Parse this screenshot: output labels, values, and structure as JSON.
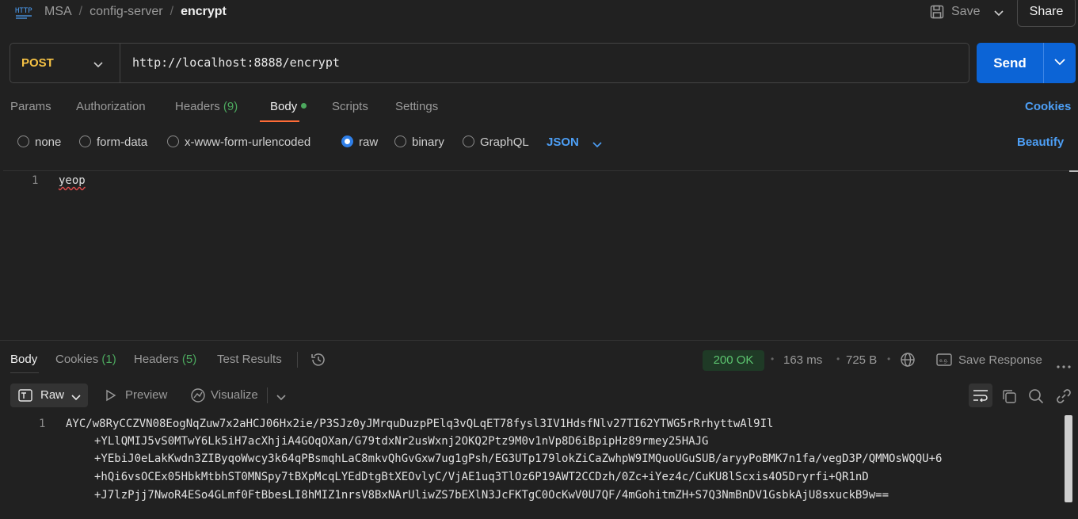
{
  "header": {
    "app_icon": "http-icon",
    "breadcrumb": [
      "MSA",
      "config-server"
    ],
    "current": "encrypt",
    "save_label": "Save",
    "share_label": "Share"
  },
  "request": {
    "method": "POST",
    "url": "http://localhost:8888/encrypt",
    "send_label": "Send"
  },
  "request_tabs": {
    "params": "Params",
    "authorization": "Authorization",
    "headers": "Headers",
    "headers_count": "(9)",
    "body": "Body",
    "scripts": "Scripts",
    "settings": "Settings",
    "cookies": "Cookies"
  },
  "body_types": {
    "none": "none",
    "form_data": "form-data",
    "urlencoded": "x-www-form-urlencoded",
    "raw": "raw",
    "binary": "binary",
    "graphql": "GraphQL",
    "selected": "raw",
    "language": "JSON",
    "beautify": "Beautify"
  },
  "editor": {
    "line_number": "1",
    "content": "yeop"
  },
  "response_tabs": {
    "body": "Body",
    "cookies": "Cookies",
    "cookies_count": "(1)",
    "headers": "Headers",
    "headers_count": "(5)",
    "test_results": "Test Results"
  },
  "response_meta": {
    "status": "200 OK",
    "time": "163 ms",
    "size": "725 B",
    "save_response": "Save Response"
  },
  "response_toolbar": {
    "format": "Raw",
    "preview": "Preview",
    "visualize": "Visualize"
  },
  "response_body": {
    "line_number": "1",
    "lines": [
      "AYC/w8RyCCZVN08EogNqZuw7x2aHCJ06Hx2ie/P3SJz0yJMrquDuzpPElq3vQLqET78fysl3IV1HdsfNlv27TI62YTWG5rRrhyttwAl9Il",
      "+YLlQMIJ5vS0MTwY6Lk5iH7acXhjiA4GOqOXan/G79tdxNr2usWxnj2OKQ2Ptz9M0v1nVp8D6iBpipHz89rmey25HAJG",
      "+YEbiJ0eLakKwdn3ZIByqoWwcy3k64qPBsmqhLaC8mkvQhGvGxw7ug1gPsh/EG3UTp179lokZiCaZwhpW9IMQuoUGuSUB/aryyPoBMK7n1fa/vegD3P/QMMOsWQQU+6",
      "+hQi6vsOCEx05HbkMtbhST0MNSpy7tBXpMcqLYEdDtgBtXEOvlyC/VjAE1uq3TlOz6P19AWT2CCDzh/0Zc+iYez4c/CuKU8lScxis4O5Dryrfi+QR1nD",
      "+J7lzPjj7NwoR4ESo4GLmf0FtBbesLI8hMIZ1nrsV8BxNArUliwZS7bEXlN3JcFKTgC0OcKwV0U7QF/4mGohitmZH+S7Q3NmBnDV1GsbkAjU8sxuckB9w=="
    ]
  },
  "colors": {
    "background": "#212121",
    "accent_blue": "#0c64d6",
    "link_blue": "#4d9ff6",
    "method_yellow": "#f6c244",
    "status_green": "#5cc46f",
    "active_tab_underline": "#ff6c37"
  }
}
